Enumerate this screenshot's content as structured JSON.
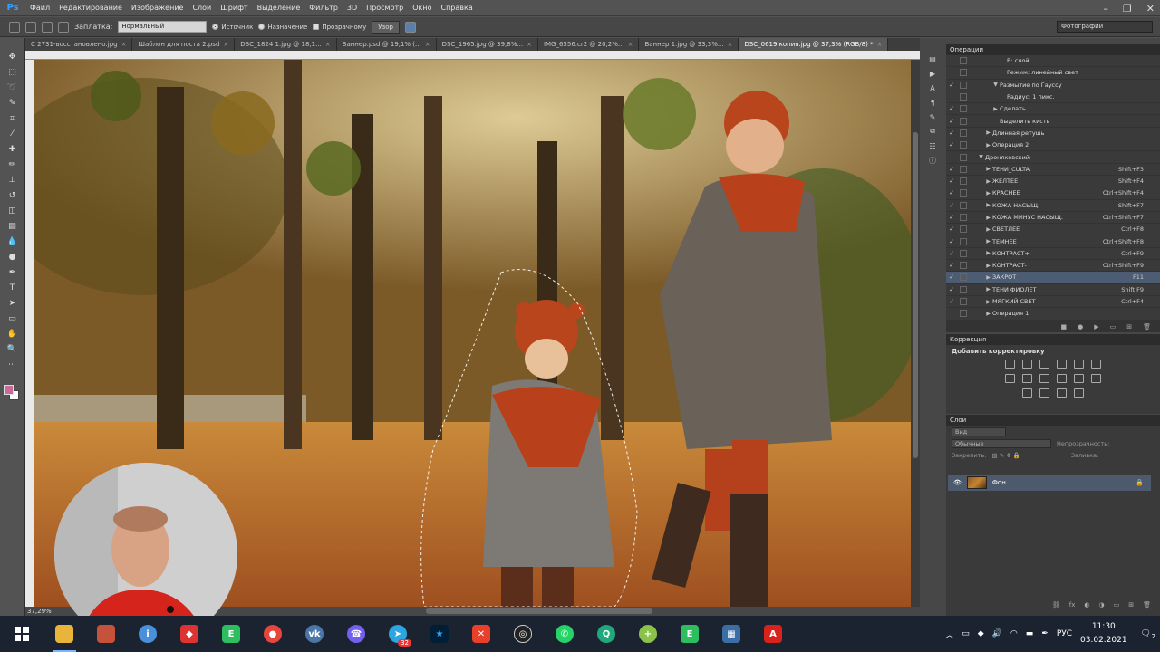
{
  "menu": {
    "logo": "Ps",
    "items": [
      "Файл",
      "Редактирование",
      "Изображение",
      "Слои",
      "Шрифт",
      "Выделение",
      "Фильтр",
      "3D",
      "Просмотр",
      "Окно",
      "Справка"
    ]
  },
  "options": {
    "patch_label": "Заплатка:",
    "mode": "Нормальный",
    "source": "Источник",
    "destination": "Назначение",
    "transparent": "Прозрачному",
    "pattern": "Узор",
    "workspace": "Фотографии"
  },
  "tabs": [
    {
      "label": "С 2731-восстановлено.jpg",
      "active": false
    },
    {
      "label": "Шаблон для поста 2.psd",
      "active": false
    },
    {
      "label": "DSC_1824 1.jpg @ 18,1...",
      "active": false
    },
    {
      "label": "Баннер.psd @ 19,1% (...",
      "active": false
    },
    {
      "label": "DSC_1965.jpg @ 39,8%...",
      "active": false
    },
    {
      "label": "IMG_6556.cr2 @ 20,2%...",
      "active": false
    },
    {
      "label": "Баннер 1.jpg @ 33,3%...",
      "active": false
    },
    {
      "label": "DSC_0619 копия.jpg @ 37,3% (RGB/8) *",
      "active": true
    }
  ],
  "status": {
    "zoom": "37,29%"
  },
  "actions_panel": {
    "title": "Операции",
    "rows": [
      {
        "name": "В: слой",
        "key": "",
        "indent": 4,
        "check": false,
        "tri": ""
      },
      {
        "name": "Режим: линейный свет",
        "key": "",
        "indent": 4,
        "check": false,
        "tri": ""
      },
      {
        "name": "Размытие по Гауссу",
        "key": "",
        "indent": 3,
        "check": true,
        "tri": "▼"
      },
      {
        "name": "Радиус: 1 пикс.",
        "key": "",
        "indent": 4,
        "check": false,
        "tri": ""
      },
      {
        "name": "Сделать",
        "key": "",
        "indent": 3,
        "check": true,
        "tri": "▶"
      },
      {
        "name": "Выделить кисть",
        "key": "",
        "indent": 3,
        "check": true,
        "tri": ""
      },
      {
        "name": "Длинная ретушь",
        "key": "",
        "indent": 2,
        "check": true,
        "tri": "▶"
      },
      {
        "name": "Операция 2",
        "key": "",
        "indent": 2,
        "check": true,
        "tri": "▶"
      },
      {
        "name": "Дроняковский",
        "key": "",
        "indent": 1,
        "check": false,
        "tri": "▼"
      },
      {
        "name": "ТЕНИ_CULTA",
        "key": "Shift+F3",
        "indent": 2,
        "check": true,
        "tri": "▶"
      },
      {
        "name": "ЖЕЛТЕЕ",
        "key": "Shift+F4",
        "indent": 2,
        "check": true,
        "tri": "▶"
      },
      {
        "name": "КРАСНЕЕ",
        "key": "Ctrl+Shift+F4",
        "indent": 2,
        "check": true,
        "tri": "▶"
      },
      {
        "name": "КОЖА НАСЫЩ.",
        "key": "Shift+F7",
        "indent": 2,
        "check": true,
        "tri": "▶"
      },
      {
        "name": "КОЖА МИНУС НАСЫЩ.",
        "key": "Ctrl+Shift+F7",
        "indent": 2,
        "check": true,
        "tri": "▶"
      },
      {
        "name": "СВЕТЛЕЕ",
        "key": "Ctrl+F8",
        "indent": 2,
        "check": true,
        "tri": "▶"
      },
      {
        "name": "ТЕМНЕЕ",
        "key": "Ctrl+Shift+F8",
        "indent": 2,
        "check": true,
        "tri": "▶"
      },
      {
        "name": "КОНТРАСТ+",
        "key": "Ctrl+F9",
        "indent": 2,
        "check": true,
        "tri": "▶"
      },
      {
        "name": "КОНТРАСТ-",
        "key": "Ctrl+Shift+F9",
        "indent": 2,
        "check": true,
        "tri": "▶"
      },
      {
        "name": "ЗАКРОТ",
        "key": "F11",
        "indent": 2,
        "check": true,
        "tri": "▶",
        "selected": true
      },
      {
        "name": "ТЕНИ ФИОЛЕТ",
        "key": "Shift F9",
        "indent": 2,
        "check": true,
        "tri": "▶"
      },
      {
        "name": "МЯГКИЙ СВЕТ",
        "key": "Ctrl+F4",
        "indent": 2,
        "check": true,
        "tri": "▶"
      },
      {
        "name": "Операция 1",
        "key": "",
        "indent": 2,
        "check": false,
        "tri": "▶"
      }
    ]
  },
  "correction_panel": {
    "title": "Коррекция",
    "add": "Добавить корректировку"
  },
  "layers_panel": {
    "title": "Слои",
    "filter": "Вид",
    "blend": "Обычные",
    "opacity_label": "Непрозрачность:",
    "lock_label": "Закрепить:",
    "fill_label": "Заливка:",
    "layer_name": "Фон"
  },
  "taskbar": {
    "lang": "РУС",
    "time": "11:30",
    "date": "03.02.2021",
    "telegram_badge": "32",
    "notif_count": "2"
  },
  "colors": {
    "foreground": "#c96b9a",
    "background": "#ffffff",
    "selected_row": "#4c5c73"
  }
}
